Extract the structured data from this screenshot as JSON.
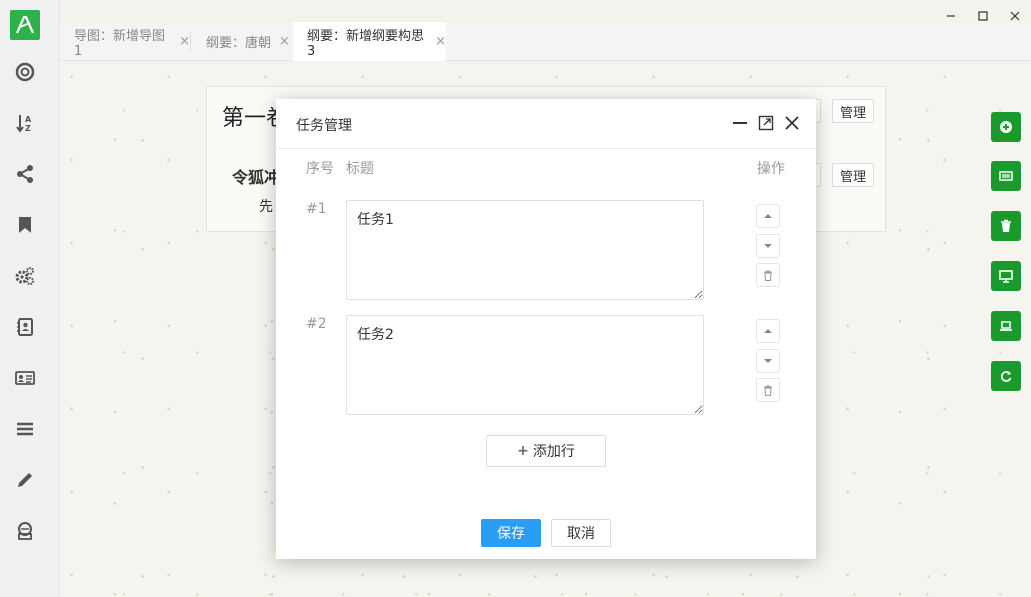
{
  "window": {
    "controls": [
      "minimize-icon",
      "maximize-icon",
      "close-icon"
    ]
  },
  "sidebar": {
    "items": [
      {
        "icon": "lifebuoy-icon"
      },
      {
        "icon": "sort-az-icon"
      },
      {
        "icon": "share-icon"
      },
      {
        "icon": "bookmark-icon"
      },
      {
        "icon": "gears-icon"
      },
      {
        "icon": "contacts-icon"
      },
      {
        "icon": "id-card-icon"
      },
      {
        "icon": "menu-icon"
      },
      {
        "icon": "pencil-icon"
      },
      {
        "icon": "hat-icon"
      }
    ]
  },
  "tabs": [
    {
      "label": "导图：新增导图1",
      "active": false
    },
    {
      "label": "纲要：唐朝",
      "active": false
    },
    {
      "label": "纲要：新增纲要构思3",
      "active": true
    }
  ],
  "tab_close": "×",
  "outline": {
    "title": "第一卷",
    "subtitle": "令狐冲",
    "text": "先",
    "manage_label": "管理"
  },
  "right_toolbar": {
    "color": "#1a9a2c",
    "buttons": [
      "add-circle-icon",
      "card-icon",
      "trash-icon",
      "monitor-icon",
      "laptop-icon",
      "refresh-icon"
    ]
  },
  "modal": {
    "title": "任务管理",
    "col_number": "序号",
    "col_title": "标题",
    "col_actions": "操作",
    "rows": [
      {
        "number": "#1",
        "value": "任务1"
      },
      {
        "number": "#2",
        "value": "任务2"
      }
    ],
    "add_row_label": "添加行",
    "add_row_icon": "+",
    "save_label": "保存",
    "cancel_label": "取消",
    "accent": "#2a9df4"
  }
}
